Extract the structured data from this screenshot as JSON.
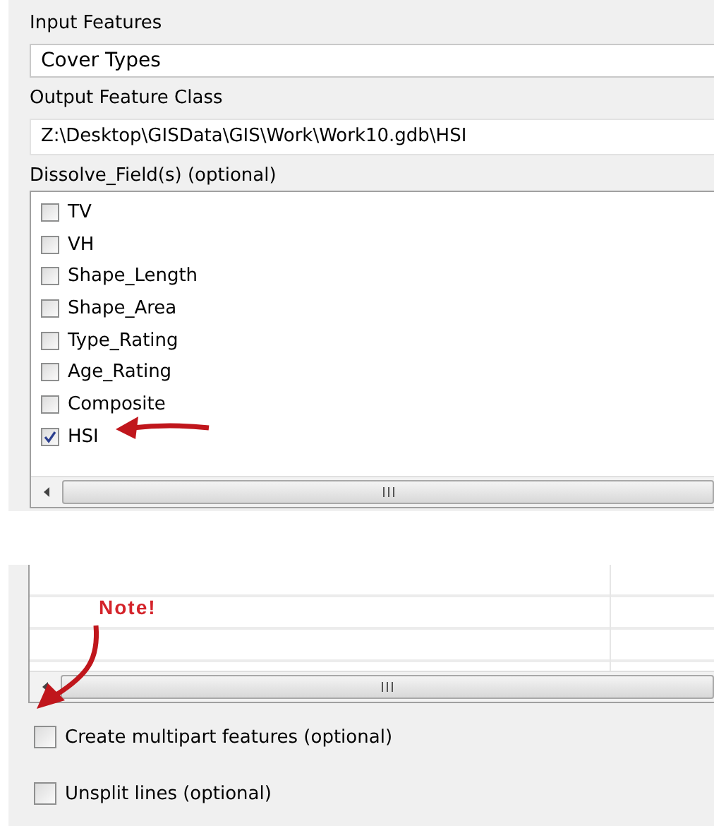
{
  "input_features": {
    "label": "Input Features",
    "value": "Cover Types"
  },
  "output_feature_class": {
    "label": "Output Feature Class",
    "value": "Z:\\Desktop\\GISData\\GIS\\Work\\Work10.gdb\\HSI"
  },
  "dissolve_fields": {
    "label": "Dissolve_Field(s) (optional)",
    "items": [
      {
        "label": "TV",
        "checked": false
      },
      {
        "label": "VH",
        "checked": false
      },
      {
        "label": "Shape_Length",
        "checked": false
      },
      {
        "label": "Shape_Area",
        "checked": false
      },
      {
        "label": "Type_Rating",
        "checked": false
      },
      {
        "label": "Age_Rating",
        "checked": false
      },
      {
        "label": "Composite",
        "checked": false
      },
      {
        "label": "HSI",
        "checked": true
      }
    ]
  },
  "note": "Note!",
  "options": [
    {
      "label": "Create multipart features (optional)",
      "checked": false
    },
    {
      "label": "Unsplit lines (optional)",
      "checked": false
    }
  ]
}
